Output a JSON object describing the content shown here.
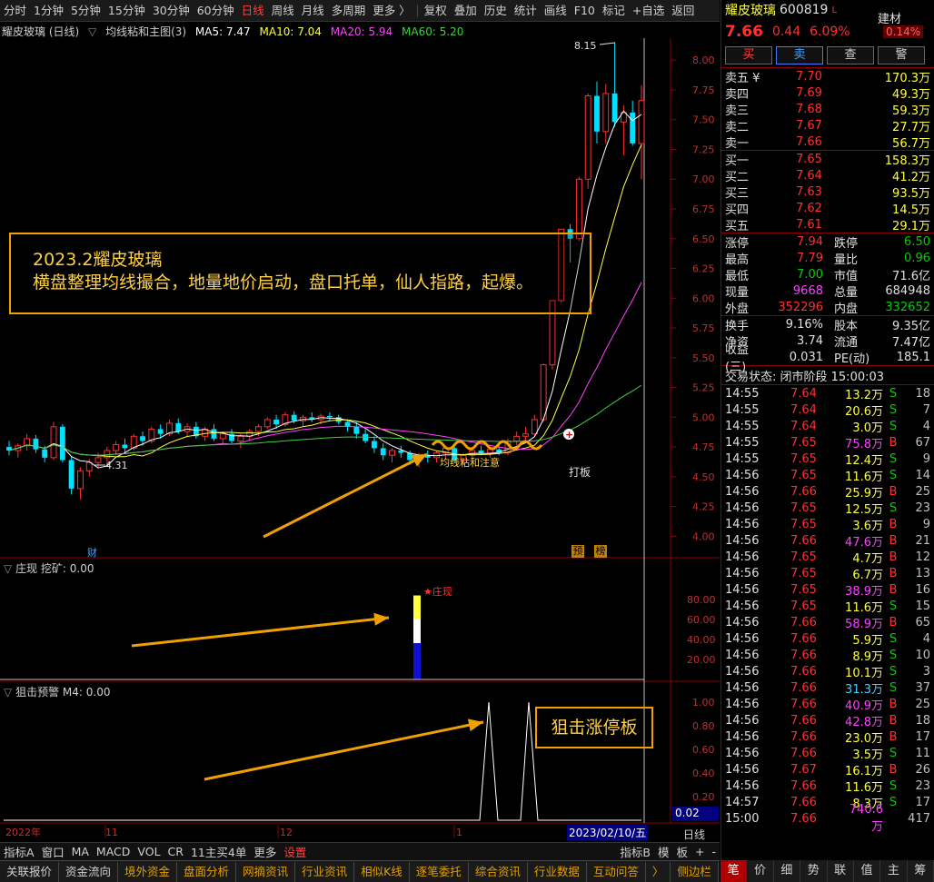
{
  "toolbar": {
    "periods": [
      "分时",
      "1分钟",
      "5分钟",
      "15分钟",
      "30分钟",
      "60分钟",
      "日线",
      "周线",
      "月线",
      "多周期",
      "更多 〉"
    ],
    "active": "日线",
    "tools": [
      "复权",
      "叠加",
      "历史",
      "统计",
      "画线",
      "F10",
      "标记",
      "+自选",
      "返回"
    ]
  },
  "chart_header": {
    "name": "耀皮玻璃 (日线)",
    "indicator": "均线粘和主图(3)",
    "ma5": "MA5: 7.47",
    "ma10": "MA10: 7.04",
    "ma20": "MA20: 5.94",
    "ma60": "MA60: 5.20"
  },
  "colors": {
    "up": "#ff3030",
    "down": "#00e0ff",
    "ma5": "#ffffff",
    "ma10": "#ffff40",
    "ma20": "#ff40ff",
    "ma60": "#40d040",
    "accent": "#f0a000"
  },
  "annotation": {
    "line1": "2023.2耀皮玻璃",
    "line2": "横盘整理均线撮合，地量地价启动，盘口托单，仙人指路，起爆。"
  },
  "labels": {
    "high_mark": "8.15",
    "low_mark": "4.31",
    "ma_sticky": "均线粘和注意",
    "daban": "打板",
    "cai": "财",
    "yu": "预",
    "bang": "榜",
    "zhuangxian_star": "★庄现",
    "sniper_box": "狙击涨停板"
  },
  "price_axis": [
    "8.00",
    "7.75",
    "7.50",
    "7.25",
    "7.00",
    "6.75",
    "6.50",
    "6.25",
    "6.00",
    "5.75",
    "5.50",
    "5.25",
    "5.00",
    "4.75",
    "4.50",
    "4.25",
    "4.00"
  ],
  "panel2": {
    "title": "庄现",
    "sub": "挖矿: 0.00",
    "axis": [
      "80.00",
      "60.00",
      "40.00",
      "20.00"
    ],
    "bar_value": 84
  },
  "panel3": {
    "title": "狙击预警",
    "sub": "M4: 0.00",
    "axis": [
      "1.00",
      "0.80",
      "0.60",
      "0.40",
      "0.20"
    ],
    "current": "0.02",
    "signals": [
      1,
      1
    ]
  },
  "time_axis": {
    "labels": [
      "2022年",
      "11",
      "12",
      "1"
    ],
    "current_date": "2023/02/10/五",
    "period": "日线"
  },
  "chart_data": {
    "type": "candlestick",
    "x": [
      "2022-10-15",
      "2023-02-10"
    ],
    "ylim": [
      3.85,
      8.2
    ],
    "ohlc": [
      [
        4.75,
        4.8,
        4.68,
        4.72
      ],
      [
        4.72,
        4.78,
        4.66,
        4.76
      ],
      [
        4.76,
        4.86,
        4.72,
        4.82
      ],
      [
        4.82,
        4.85,
        4.7,
        4.73
      ],
      [
        4.73,
        4.76,
        4.62,
        4.66
      ],
      [
        4.66,
        4.96,
        4.64,
        4.92
      ],
      [
        4.92,
        4.94,
        4.62,
        4.64
      ],
      [
        4.64,
        4.67,
        4.35,
        4.4
      ],
      [
        4.4,
        4.58,
        4.31,
        4.55
      ],
      [
        4.55,
        4.65,
        4.5,
        4.62
      ],
      [
        4.62,
        4.7,
        4.58,
        4.66
      ],
      [
        4.66,
        4.75,
        4.6,
        4.72
      ],
      [
        4.72,
        4.8,
        4.68,
        4.77
      ],
      [
        4.77,
        4.82,
        4.7,
        4.74
      ],
      [
        4.74,
        4.86,
        4.72,
        4.84
      ],
      [
        4.84,
        4.88,
        4.76,
        4.8
      ],
      [
        4.8,
        4.92,
        4.78,
        4.9
      ],
      [
        4.9,
        4.94,
        4.82,
        4.86
      ],
      [
        4.86,
        4.98,
        4.84,
        4.95
      ],
      [
        4.95,
        4.99,
        4.86,
        4.88
      ],
      [
        4.88,
        4.95,
        4.84,
        4.92
      ],
      [
        4.92,
        4.96,
        4.82,
        4.84
      ],
      [
        4.84,
        4.92,
        4.8,
        4.9
      ],
      [
        4.9,
        4.94,
        4.8,
        4.82
      ],
      [
        4.82,
        4.88,
        4.78,
        4.86
      ],
      [
        4.86,
        4.9,
        4.78,
        4.8
      ],
      [
        4.8,
        4.86,
        4.74,
        4.84
      ],
      [
        4.84,
        4.9,
        4.8,
        4.88
      ],
      [
        4.88,
        4.94,
        4.84,
        4.92
      ],
      [
        4.92,
        5.0,
        4.9,
        4.98
      ],
      [
        4.98,
        5.02,
        4.9,
        4.94
      ],
      [
        4.94,
        5.04,
        4.92,
        5.02
      ],
      [
        5.02,
        5.05,
        4.95,
        4.97
      ],
      [
        4.97,
        5.02,
        4.92,
        5.0
      ],
      [
        5.0,
        5.04,
        4.96,
        4.98
      ],
      [
        4.98,
        5.03,
        4.94,
        5.01
      ],
      [
        5.01,
        5.04,
        4.97,
        5.0
      ],
      [
        5.0,
        5.02,
        4.94,
        4.96
      ],
      [
        4.96,
        4.98,
        4.88,
        4.92
      ],
      [
        4.92,
        4.96,
        4.82,
        4.86
      ],
      [
        4.86,
        4.9,
        4.78,
        4.8
      ],
      [
        4.8,
        4.84,
        4.7,
        4.74
      ],
      [
        4.74,
        4.78,
        4.64,
        4.68
      ],
      [
        4.68,
        4.74,
        4.62,
        4.72
      ],
      [
        4.72,
        4.76,
        4.66,
        4.7
      ],
      [
        4.7,
        4.72,
        4.6,
        4.64
      ],
      [
        4.64,
        4.7,
        4.58,
        4.68
      ],
      [
        4.68,
        4.72,
        4.62,
        4.66
      ],
      [
        4.66,
        4.72,
        4.62,
        4.7
      ],
      [
        4.7,
        4.76,
        4.66,
        4.74
      ],
      [
        4.74,
        4.76,
        4.62,
        4.64
      ],
      [
        4.64,
        4.7,
        4.6,
        4.68
      ],
      [
        4.68,
        4.74,
        4.64,
        4.72
      ],
      [
        4.72,
        4.76,
        4.68,
        4.7
      ],
      [
        4.7,
        4.75,
        4.66,
        4.73
      ],
      [
        4.73,
        4.78,
        4.68,
        4.7
      ],
      [
        4.7,
        4.82,
        4.68,
        4.8
      ],
      [
        4.8,
        4.88,
        4.76,
        4.84
      ],
      [
        4.84,
        4.92,
        4.8,
        4.86
      ],
      [
        4.86,
        5.02,
        4.84,
        4.98
      ],
      [
        4.98,
        5.45,
        4.96,
        5.44
      ],
      [
        5.44,
        5.98,
        5.4,
        5.98
      ],
      [
        5.98,
        6.58,
        5.96,
        6.58
      ],
      [
        6.58,
        6.62,
        6.3,
        6.5
      ],
      [
        6.5,
        7.02,
        6.48,
        7.0
      ],
      [
        7.0,
        7.72,
        6.92,
        7.7
      ],
      [
        7.7,
        7.82,
        7.3,
        7.4
      ],
      [
        7.4,
        7.8,
        7.3,
        7.72
      ],
      [
        7.72,
        8.15,
        7.44,
        7.48
      ],
      [
        7.48,
        7.62,
        7.2,
        7.56
      ],
      [
        7.56,
        7.66,
        7.28,
        7.3
      ],
      [
        7.3,
        7.79,
        7.0,
        7.66
      ]
    ],
    "zhuangxian_values": [
      0,
      0,
      0,
      0,
      0,
      0,
      0,
      0,
      0,
      0,
      0,
      0,
      0,
      0,
      0,
      0,
      0,
      0,
      0,
      0,
      0,
      0,
      0,
      0,
      0,
      0,
      0,
      0,
      0,
      0,
      0,
      0,
      0,
      0,
      0,
      0,
      0,
      0,
      0,
      0,
      0,
      0,
      0,
      0,
      0,
      0,
      0,
      0,
      84,
      0,
      0,
      0,
      0,
      0,
      0,
      0,
      0,
      0,
      0,
      0,
      0,
      0,
      0,
      0,
      0,
      0,
      0,
      0,
      0,
      0,
      0,
      0
    ]
  },
  "quote": {
    "name": "耀皮玻璃",
    "code": "600819",
    "sector": "建材",
    "price": "7.66",
    "change": "0.44",
    "pct": "6.09%",
    "sector_pct": "0.14%",
    "buttons": [
      "买",
      "卖",
      "查",
      "警"
    ],
    "asks": [
      {
        "label": "卖五 ¥",
        "price": "7.70",
        "vol": "170.3万"
      },
      {
        "label": "卖四",
        "price": "7.69",
        "vol": "49.3万"
      },
      {
        "label": "卖三",
        "price": "7.68",
        "vol": "59.3万"
      },
      {
        "label": "卖二",
        "price": "7.67",
        "vol": "27.7万"
      },
      {
        "label": "卖一",
        "price": "7.66",
        "vol": "56.7万"
      }
    ],
    "bids": [
      {
        "label": "买一",
        "price": "7.65",
        "vol": "158.3万"
      },
      {
        "label": "买二",
        "price": "7.64",
        "vol": "41.2万"
      },
      {
        "label": "买三",
        "price": "7.63",
        "vol": "93.5万"
      },
      {
        "label": "买四",
        "price": "7.62",
        "vol": "14.5万"
      },
      {
        "label": "买五",
        "price": "7.61",
        "vol": "29.1万"
      }
    ],
    "stats1": [
      {
        "l1": "涨停",
        "v1": "7.94",
        "l2": "跌停",
        "v2": "6.50"
      },
      {
        "l1": "最高",
        "v1": "7.79",
        "l2": "量比",
        "v2": "0.96"
      },
      {
        "l1": "最低",
        "v1": "7.00",
        "l2": "市值",
        "v2": "71.6亿"
      },
      {
        "l1": "现量",
        "v1": "9668",
        "l2": "总量",
        "v2": "684948"
      },
      {
        "l1": "外盘",
        "v1": "352296",
        "l2": "内盘",
        "v2": "332652"
      }
    ],
    "stats2": [
      {
        "l1": "换手",
        "v1": "9.16%",
        "l2": "股本",
        "v2": "9.35亿"
      },
      {
        "l1": "净资",
        "v1": "3.74",
        "l2": "流通",
        "v2": "7.47亿"
      },
      {
        "l1": "收益(三)",
        "v1": "0.031",
        "l2": "PE(动)",
        "v2": "185.1"
      }
    ],
    "status": "交易状态: 闭市阶段 15:00:03"
  },
  "ticks": [
    [
      "14:55",
      "7.64",
      "13.2万",
      "S",
      "18"
    ],
    [
      "14:55",
      "7.64",
      "20.6万",
      "S",
      "7"
    ],
    [
      "14:55",
      "7.64",
      "3.0万",
      "S",
      "4"
    ],
    [
      "14:55",
      "7.65",
      "75.8万",
      "B",
      "67"
    ],
    [
      "14:55",
      "7.65",
      "12.4万",
      "S",
      "9"
    ],
    [
      "14:56",
      "7.65",
      "11.6万",
      "S",
      "14"
    ],
    [
      "14:56",
      "7.66",
      "25.9万",
      "B",
      "25"
    ],
    [
      "14:56",
      "7.65",
      "12.5万",
      "S",
      "23"
    ],
    [
      "14:56",
      "7.65",
      "3.6万",
      "B",
      "9"
    ],
    [
      "14:56",
      "7.66",
      "47.6万",
      "B",
      "21"
    ],
    [
      "14:56",
      "7.65",
      "4.7万",
      "B",
      "12"
    ],
    [
      "14:56",
      "7.65",
      "6.7万",
      "B",
      "13"
    ],
    [
      "14:56",
      "7.65",
      "38.9万",
      "B",
      "16"
    ],
    [
      "14:56",
      "7.65",
      "11.6万",
      "S",
      "15"
    ],
    [
      "14:56",
      "7.66",
      "58.9万",
      "B",
      "65"
    ],
    [
      "14:56",
      "7.66",
      "5.9万",
      "S",
      "4"
    ],
    [
      "14:56",
      "7.66",
      "8.9万",
      "S",
      "10"
    ],
    [
      "14:56",
      "7.66",
      "10.1万",
      "S",
      "3"
    ],
    [
      "14:56",
      "7.66",
      "31.3万",
      "S",
      "37"
    ],
    [
      "14:56",
      "7.66",
      "40.9万",
      "B",
      "25"
    ],
    [
      "14:56",
      "7.66",
      "42.8万",
      "B",
      "18"
    ],
    [
      "14:56",
      "7.66",
      "23.0万",
      "B",
      "17"
    ],
    [
      "14:56",
      "7.66",
      "3.5万",
      "S",
      "11"
    ],
    [
      "14:56",
      "7.67",
      "16.1万",
      "B",
      "26"
    ],
    [
      "14:56",
      "7.66",
      "11.6万",
      "S",
      "23"
    ],
    [
      "14:57",
      "7.66",
      "8.3万",
      "S",
      "17"
    ],
    [
      "15:00",
      "7.66",
      "740.6万",
      "",
      "417"
    ]
  ],
  "bottom1": [
    "指标A",
    "窗口",
    "MA",
    "MACD",
    "VOL",
    "CR",
    "11主买4单",
    "更多",
    "设置"
  ],
  "bottom1_right": [
    "指标B",
    "模",
    "板",
    "+",
    "-"
  ],
  "bottom2": [
    "关联报价",
    "资金流向",
    "境外资金",
    "盘面分析",
    "网摘资讯",
    "行业资讯",
    "相似K线",
    "逐笔委托",
    "综合资讯",
    "行业数据",
    "互动问答",
    "〉",
    "侧边栏"
  ],
  "right_tabs": [
    "笔",
    "价",
    "细",
    "势",
    "联",
    "值",
    "主",
    "筹"
  ],
  "right_tab_active": "笔"
}
